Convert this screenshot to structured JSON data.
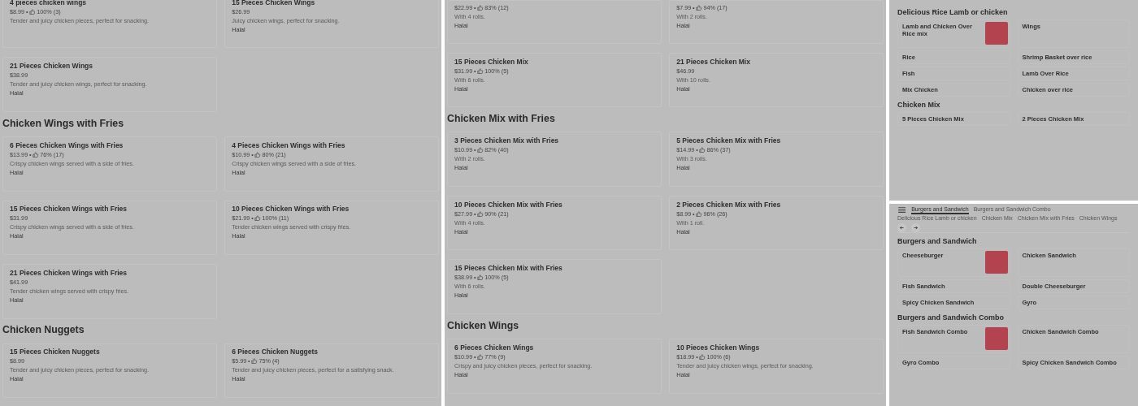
{
  "panels": [
    {
      "kind": "large",
      "sections": [
        {
          "items": [
            {
              "name": "4 pieces chicken wings",
              "price": "$8.99",
              "separator": "•",
              "rating": "100% (3)",
              "description": "Tender and juicy chicken pieces, perfect for snacking."
            },
            {
              "name": "15 Pieces Chicken Wings",
              "price": "$26.99",
              "description": "Juicy chicken wings, perfect for snacking.",
              "tag": "Halal"
            },
            {
              "name": "21 Pieces Chicken Wings",
              "price": "$38.99",
              "description": "Tender and juicy chicken wings, perfect for snacking.",
              "tag": "Halal"
            }
          ]
        },
        {
          "title": "Chicken Wings with Fries",
          "items": [
            {
              "name": "6 Pieces Chicken Wings with Fries",
              "price": "$13.99",
              "separator": "•",
              "rating": "76% (17)",
              "description": "Crispy chicken wings served with a side of fries.",
              "tag": "Halal"
            },
            {
              "name": "4 Pieces Chicken Wings with Fries",
              "price": "$10.99",
              "separator": "•",
              "rating": "80% (21)",
              "description": "Crispy chicken wings served with a side of fries.",
              "tag": "Halal"
            },
            {
              "name": "15 Pieces Chicken Wings with Fries",
              "price": "$31.99",
              "description": "Crispy chicken wings served with a side of fries.",
              "tag": "Halal"
            },
            {
              "name": "10 Pieces Chicken Wings with Fries",
              "price": "$21.99",
              "separator": "•",
              "rating": "100% (11)",
              "description": "Tender chicken wings served with crispy fries.",
              "tag": "Halal"
            },
            {
              "name": "21 Pieces Chicken Wings with Fries",
              "price": "$41.99",
              "description": "Tender chicken wings served with crispy fries.",
              "tag": "Halal"
            }
          ]
        },
        {
          "title": "Chicken Nuggets",
          "items": [
            {
              "name": "15 Pieces Chicken Nuggets",
              "price": "$8.99",
              "description": "Tender and juicy chicken pieces, perfect for snacking.",
              "tag": "Halal"
            },
            {
              "name": "6 Pieces Chicken Nuggets",
              "price": "$5.99",
              "separator": "•",
              "rating": "75% (4)",
              "description": "Tender and juicy chicken pieces, perfect for a satisfying snack.",
              "tag": "Halal"
            }
          ]
        }
      ]
    },
    {
      "kind": "large",
      "sections": [
        {
          "items": [
            {
              "price": "$22.99",
              "separator": "•",
              "rating": "83% (12)",
              "description": "With 4 rolls.",
              "tag": "Halal"
            },
            {
              "price": "$7.99",
              "separator": "•",
              "rating": "94% (17)",
              "description": "With 2 rolls.",
              "tag": "Halal"
            },
            {
              "name": "15 Pieces Chicken Mix",
              "price": "$31.99",
              "separator": "•",
              "rating": "100% (5)",
              "description": "With 6 rolls.",
              "tag": "Halal"
            },
            {
              "name": "21 Pieces Chicken Mix",
              "price": "$46.99",
              "description": "With 10 rolls.",
              "tag": "Halal"
            }
          ]
        },
        {
          "title": "Chicken Mix with Fries",
          "items": [
            {
              "name": "3 Pieces Chicken Mix with Fries",
              "price": "$10.99",
              "separator": "•",
              "rating": "82% (40)",
              "description": "With 2 rolls.",
              "tag": "Halal"
            },
            {
              "name": "5 Pieces Chicken Mix with Fries",
              "price": "$14.99",
              "separator": "•",
              "rating": "86% (37)",
              "description": "With 3 rolls.",
              "tag": "Halal"
            },
            {
              "name": "10 Pieces Chicken Mix with Fries",
              "price": "$27.99",
              "separator": "•",
              "rating": "90% (21)",
              "description": "With 4 rolls.",
              "tag": "Halal"
            },
            {
              "name": "2 Pieces Chicken Mix with Fries",
              "price": "$8.99",
              "separator": "•",
              "rating": "96% (26)",
              "description": "With 1 roll.",
              "tag": "Halal"
            },
            {
              "name": "15 Pieces Chicken Mix with Fries",
              "price": "$38.99",
              "separator": "•",
              "rating": "100% (5)",
              "description": "With 6 rolls.",
              "tag": "Halal"
            }
          ]
        },
        {
          "title": "Chicken Wings",
          "items": [
            {
              "name": "6 Pieces Chicken Wings",
              "price": "$10.99",
              "separator": "•",
              "rating": "77% (9)",
              "description": "Crispy and juicy chicken pieces, perfect for snacking.",
              "tag": "Halal"
            },
            {
              "name": "10 Pieces Chicken Wings",
              "price": "$18.99",
              "separator": "•",
              "rating": "100% (6)",
              "description": "Tender and juicy chicken wings, perfect for snacking.",
              "tag": "Halal"
            }
          ]
        }
      ]
    },
    {
      "kind": "small",
      "sections": [
        {
          "title": "Delicious Rice Lamb or chicken",
          "items": [
            {
              "name": "Lamb and Chicken Over Rice mix",
              "photo": true
            },
            {
              "name": "Wings"
            },
            {
              "name": "Rice"
            },
            {
              "name": "Shrimp Basket over rice"
            },
            {
              "name": "Fish"
            },
            {
              "name": "Lamb Over Rice"
            },
            {
              "name": "Mix Chicken"
            },
            {
              "name": "Chicken over rice"
            }
          ]
        },
        {
          "title": "Chicken Mix",
          "items": [
            {
              "name": "5 Pieces Chicken Mix"
            },
            {
              "name": "2 Pieces Chicken Mix"
            }
          ]
        }
      ]
    },
    {
      "kind": "small",
      "tabs": [
        {
          "label": "Burgers and Sandwich",
          "selected": true
        },
        {
          "label": "Burgers and Sandwich Combo",
          "selected": false
        },
        {
          "label": "Delicious Rice Lamb or chicken",
          "selected": false
        },
        {
          "label": "Chicken Mix",
          "selected": false
        },
        {
          "label": "Chicken Mix with Fries",
          "selected": false
        },
        {
          "label": "Chicken Wings",
          "selected": false
        }
      ],
      "sections": [
        {
          "title": "Burgers and Sandwich",
          "items": [
            {
              "name": "Cheeseburger",
              "photo": true
            },
            {
              "name": "Chicken Sandwich"
            },
            {
              "name": "Fish Sandwich"
            },
            {
              "name": "Double Cheeseburger"
            },
            {
              "name": "Spicy Chicken Sandwich"
            },
            {
              "name": "Gyro"
            }
          ]
        },
        {
          "title": "Burgers and Sandwich Combo",
          "items": [
            {
              "name": "Fish Sandwich Combo",
              "photo": true
            },
            {
              "name": "Chicken Sandwich Combo"
            },
            {
              "name": "Gyro Combo"
            },
            {
              "name": "Spicy Chicken Sandwich Combo"
            }
          ]
        }
      ]
    }
  ]
}
